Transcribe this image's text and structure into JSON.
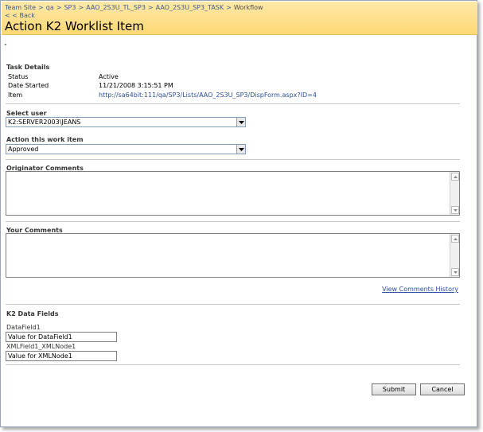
{
  "breadcrumb": {
    "items": [
      "Team Site",
      "qa",
      "SP3",
      "AAO_2S3U_TL_SP3",
      "AAO_2S3U_SP3_TASK",
      "Workflow"
    ],
    "separator": ">"
  },
  "back_label": "< < Back",
  "page_title": "Action K2  Worklist Item",
  "task_details": {
    "heading": "Task Details",
    "rows": [
      {
        "label": "Status",
        "value": "Active"
      },
      {
        "label": "Date Started",
        "value": "11/21/2008 3:15:51 PM"
      },
      {
        "label": "Item",
        "value": "http://sa64bit:111/qa/SP3/Lists/AAO_2S3U_SP3/DispForm.aspx?ID=4"
      }
    ]
  },
  "select_user": {
    "label": "Select user",
    "value": "K2:SERVER2003\\JEANS"
  },
  "action_item": {
    "label": "Action this work item",
    "value": "Approved"
  },
  "originator_comments": {
    "label": "Originator Comments"
  },
  "your_comments": {
    "label": "Your Comments"
  },
  "history_link": "View Comments History",
  "data_fields": {
    "heading": "K2  Data Fields",
    "fields": [
      {
        "label": "DataField1",
        "value": "Value for DataField1"
      },
      {
        "label": "XMLField1_XMLNode1",
        "value": "Value for XMLNode1"
      }
    ]
  },
  "buttons": {
    "submit": "Submit",
    "cancel": "Cancel"
  },
  "colors": {
    "header_top": "#ffe9a8",
    "header_bottom": "#fdd875",
    "link": "#2b4fa0"
  }
}
